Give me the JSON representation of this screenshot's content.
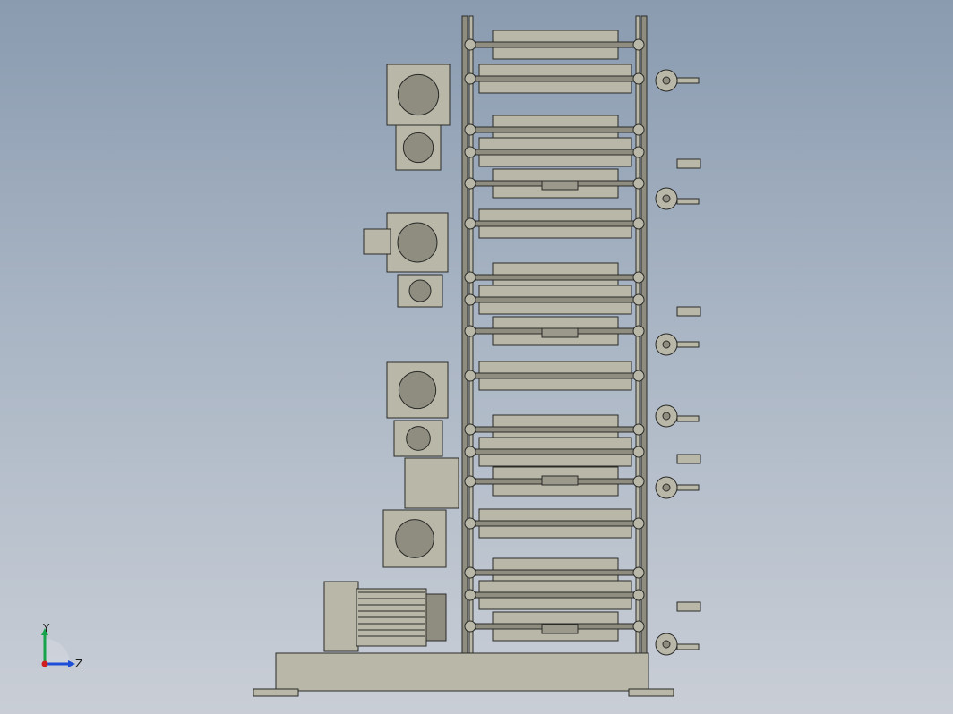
{
  "view": {
    "background_top": "#8a9bb0",
    "background_bottom": "#c9ced6",
    "part_fill": "#b9b8a8",
    "part_shade": "#8e8d80",
    "edge_color": "#2a2a28"
  },
  "triad": {
    "y_label": "Y",
    "z_label": "Z",
    "x_axis_color": "#d11f1f",
    "y_axis_color": "#16a34a",
    "z_axis_color": "#1d4ed8"
  },
  "model": {
    "stations": 4,
    "icons": [
      "motor-icon",
      "gearbox-icon",
      "handwheel-icon",
      "roller-icon"
    ]
  }
}
